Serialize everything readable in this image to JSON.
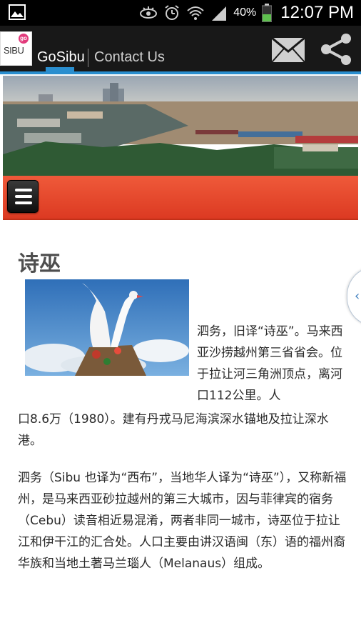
{
  "status_bar": {
    "battery_percent": "40%",
    "time": "12:07 PM",
    "icons": [
      "image-icon",
      "eye-icon",
      "alarm-icon",
      "wifi-icon",
      "signal-icon",
      "battery-icon"
    ]
  },
  "action_bar": {
    "logo_text": "SIBU",
    "logo_badge": "go",
    "tabs": [
      {
        "label": "GoSibu",
        "active": true
      },
      {
        "label": "Contact Us",
        "active": false
      }
    ],
    "icons": [
      "mail-icon",
      "share-icon"
    ],
    "accent_color": "#2a8ecf"
  },
  "menu": {
    "icon": "hamburger-menu-icon",
    "bar_color": "#e2432a"
  },
  "article": {
    "title": "诗巫",
    "paragraph1_side": "泗务，旧译“诗巫”。马来西亚沙捞越州第三省省会。位于拉让河三角洲顶点，离河口112公里。人",
    "paragraph1_rest": "口8.6万（1980）。建有丹戎马尼海滨深水锚地及拉让深水港。",
    "paragraph2": "泗务（Sibu 也译为“西布”，当地华人译为“诗巫”），又称新福州，是马来西亚砂拉越州的第三大城市，因与菲律宾的宿务（Cebu）读音相近易混淆，两者非同一城市，诗巫位于拉让江和伊干江的汇合处。人口主要由讲汉语闽（东）语的福州裔华族和当地土著马兰瑙人（Melanaus）组成。"
  },
  "side_handle": {
    "glyph": "‹"
  }
}
